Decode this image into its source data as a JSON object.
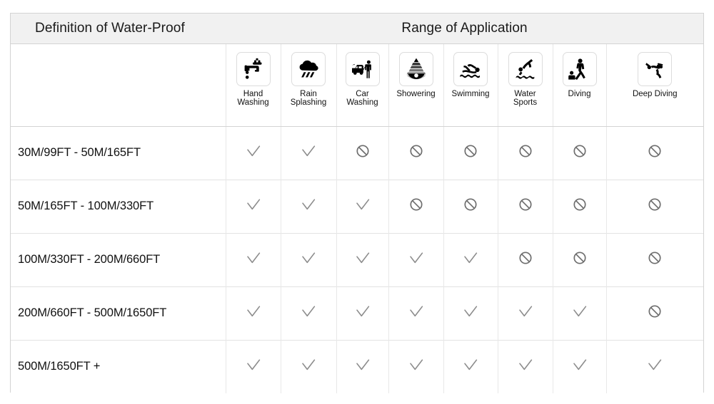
{
  "header": {
    "definition_title": "Definition of Water-Proof",
    "range_title": "Range of Application"
  },
  "columns": [
    {
      "icon": "faucet-hand-washing-icon",
      "label": "Hand\nWashing",
      "label_line1": "Hand",
      "label_line2": "Washing"
    },
    {
      "icon": "rain-cloud-icon",
      "label": "Rain\nSplashing",
      "label_line1": "Rain",
      "label_line2": "Splashing"
    },
    {
      "icon": "car-washing-icon",
      "label": "Car\nWashing",
      "label_line1": "Car",
      "label_line2": "Washing"
    },
    {
      "icon": "shower-head-icon",
      "label": "Showering",
      "label_line1": "Showering",
      "label_line2": ""
    },
    {
      "icon": "swimmer-icon",
      "label": "Swimming",
      "label_line1": "Swimming",
      "label_line2": ""
    },
    {
      "icon": "water-sports-diving-board-icon",
      "label": "Water\nSports",
      "label_line1": "Water",
      "label_line2": "Sports"
    },
    {
      "icon": "diving-icon",
      "label": "Diving",
      "label_line1": "Diving",
      "label_line2": ""
    },
    {
      "icon": "deep-diving-scuba-icon",
      "label": "Deep Diving",
      "label_line1": "Deep Diving",
      "label_line2": ""
    }
  ],
  "rows": [
    {
      "label": "30M/99FT  -  50M/165FT",
      "cells": [
        "check",
        "check",
        "no",
        "no",
        "no",
        "no",
        "no",
        "no"
      ]
    },
    {
      "label": "50M/165FT  -  100M/330FT",
      "cells": [
        "check",
        "check",
        "check",
        "no",
        "no",
        "no",
        "no",
        "no"
      ]
    },
    {
      "label": "100M/330FT   -  200M/660FT",
      "cells": [
        "check",
        "check",
        "check",
        "check",
        "check",
        "no",
        "no",
        "no"
      ]
    },
    {
      "label": "200M/660FT  -  500M/1650FT",
      "cells": [
        "check",
        "check",
        "check",
        "check",
        "check",
        "check",
        "check",
        "no"
      ]
    },
    {
      "label": "500M/1650FT  +",
      "cells": [
        "check",
        "check",
        "check",
        "check",
        "check",
        "check",
        "check",
        "check"
      ]
    }
  ],
  "marks": {
    "check_name": "check-icon",
    "no_name": "prohibited-icon",
    "check_color": "#8c8c8c",
    "no_color": "#6e6e6e"
  },
  "colors": {
    "title_band": "#f1f1f1",
    "border": "#d3d3d3",
    "grid": "#e6e6e6",
    "text": "#111111",
    "icon": "#000000"
  }
}
